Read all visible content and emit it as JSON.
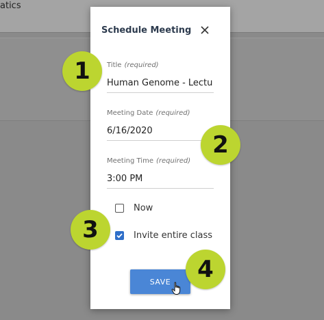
{
  "background": {
    "header_text": "atics"
  },
  "dialog": {
    "title": "Schedule Meeting",
    "close_icon": "close-icon"
  },
  "fields": {
    "title": {
      "label": "Title",
      "required": "(required)",
      "value": "Human Genome - Lectu"
    },
    "date": {
      "label": "Meeting Date",
      "required": "(required)",
      "value": "6/16/2020"
    },
    "time": {
      "label": "Meeting Time",
      "required": "(required)",
      "value": "3:00 PM"
    }
  },
  "checkboxes": {
    "now": {
      "label": "Now",
      "checked": false
    },
    "invite": {
      "label": "Invite entire class",
      "checked": true
    }
  },
  "save_label": "SAVE",
  "callouts": [
    "1",
    "2",
    "3",
    "4"
  ],
  "colors": {
    "accent": "#4a86d6",
    "checkbox": "#2f6fc9",
    "callout": "#bcd530",
    "title": "#2d3b4e"
  }
}
